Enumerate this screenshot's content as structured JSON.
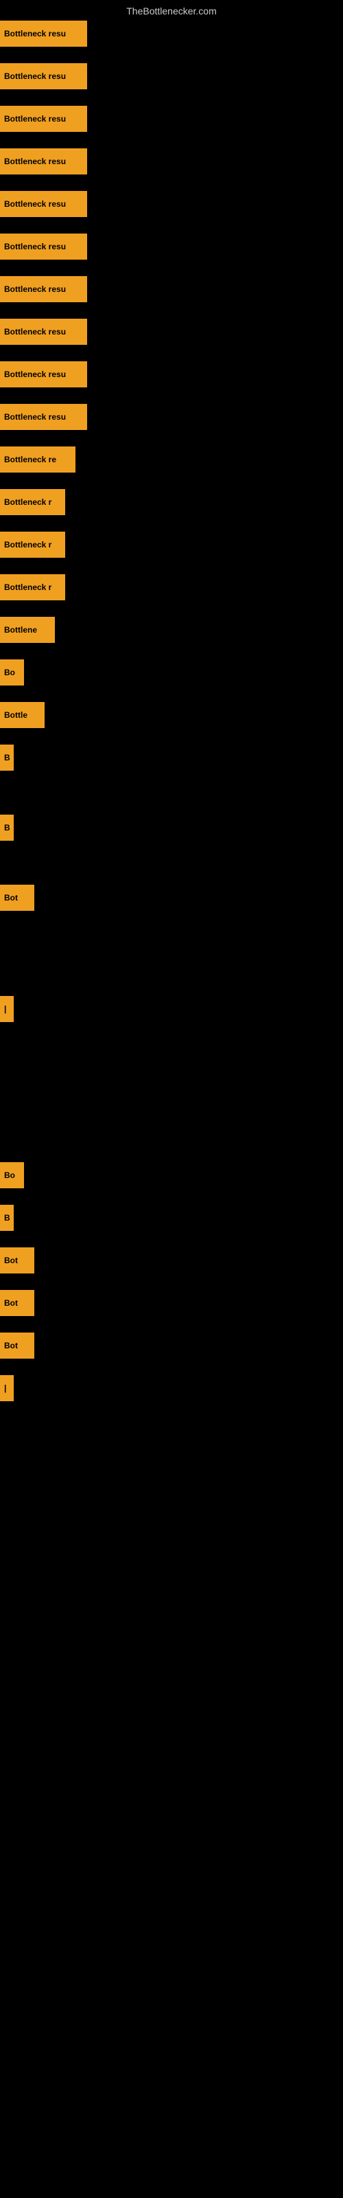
{
  "site": {
    "title": "TheBottlenecker.com"
  },
  "items": [
    {
      "label": "Bottleneck resu",
      "width": "full",
      "position": 1
    },
    {
      "label": "Bottleneck resu",
      "width": "full",
      "position": 2
    },
    {
      "label": "Bottleneck resu",
      "width": "full",
      "position": 3
    },
    {
      "label": "Bottleneck resu",
      "width": "full",
      "position": 4
    },
    {
      "label": "Bottleneck resu",
      "width": "full",
      "position": 5
    },
    {
      "label": "Bottleneck resu",
      "width": "full",
      "position": 6
    },
    {
      "label": "Bottleneck resu",
      "width": "full",
      "position": 7
    },
    {
      "label": "Bottleneck resu",
      "width": "full",
      "position": 8
    },
    {
      "label": "Bottleneck resu",
      "width": "full",
      "position": 9
    },
    {
      "label": "Bottleneck resu",
      "width": "full",
      "position": 10
    },
    {
      "label": "Bottleneck re",
      "width": "110",
      "position": 11
    },
    {
      "label": "Bottleneck r",
      "width": "95",
      "position": 12
    },
    {
      "label": "Bottleneck r",
      "width": "95",
      "position": 13
    },
    {
      "label": "Bottleneck r",
      "width": "95",
      "position": 14
    },
    {
      "label": "Bottlene",
      "width": "80",
      "position": 15
    },
    {
      "label": "Bo",
      "width": "35",
      "position": 16
    },
    {
      "label": "Bottle",
      "width": "65",
      "position": 17
    },
    {
      "label": "B",
      "width": "20",
      "position": 18
    },
    {
      "label": "B",
      "width": "20",
      "position": 19
    },
    {
      "label": "Bot",
      "width": "50",
      "position": 20
    },
    {
      "label": "|",
      "width": "15",
      "position": 21
    },
    {
      "label": "B",
      "width": "20",
      "position": 22
    },
    {
      "label": "B",
      "width": "20",
      "position": 23
    },
    {
      "label": "Bot",
      "width": "50",
      "position": 24
    },
    {
      "label": "B",
      "width": "20",
      "position": 25
    },
    {
      "label": "Bot",
      "width": "50",
      "position": 26
    },
    {
      "label": "B",
      "width": "20",
      "position": 27
    },
    {
      "label": "|",
      "width": "15",
      "position": 28
    }
  ]
}
